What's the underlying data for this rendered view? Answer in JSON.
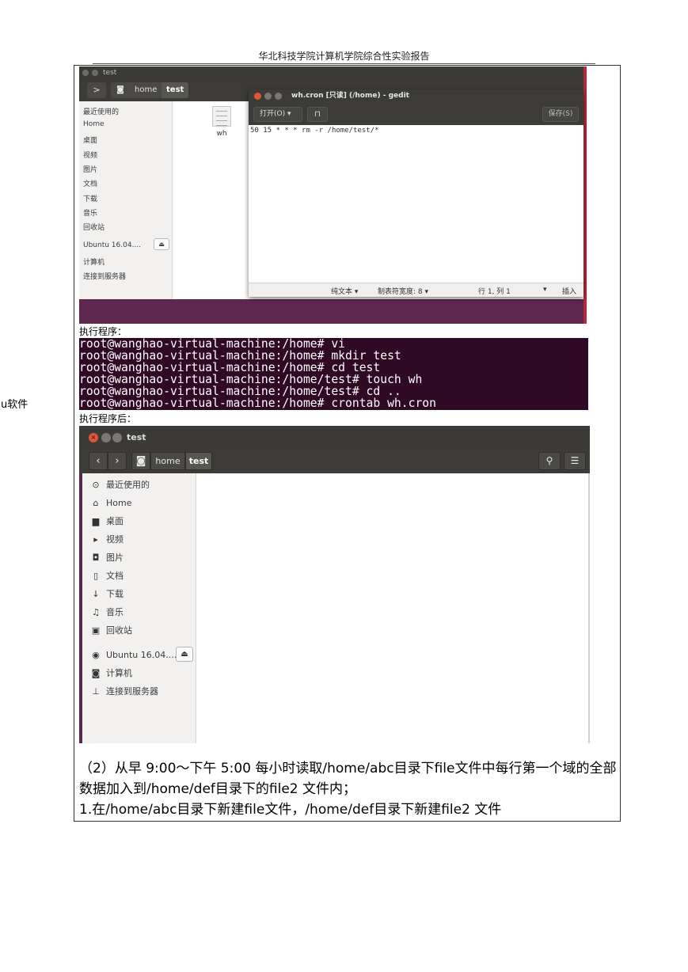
{
  "header": {
    "text": "华北科技学院计算机学院综合性实验报告"
  },
  "screenshot1": {
    "window_title": "test",
    "breadcrumb": {
      "home": "home",
      "current": "test"
    },
    "sidebar": [
      "最近使用的",
      "Home",
      "桌面",
      "视频",
      "图片",
      "文档",
      "下载",
      "音乐",
      "回收站",
      "Ubuntu 16.04....",
      "计算机",
      "连接到服务器"
    ],
    "file_name": "wh",
    "gedit": {
      "title": "wh.cron [只读] (/home) - gedit",
      "open_label": "打开(O) ▾",
      "save_label": "保存(S)",
      "content": "50 15 * * * rm -r /home/test/*",
      "status": {
        "mode": "纯文本 ▾",
        "tab": "制表符宽度: 8 ▾",
        "pos": "行 1, 列 1",
        "insert": "插入"
      }
    }
  },
  "label_before": "执行程序：",
  "terminal": {
    "lines": [
      "root@wanghao-virtual-machine:/home# vi",
      "root@wanghao-virtual-machine:/home# mkdir test",
      "root@wanghao-virtual-machine:/home# cd test",
      "root@wanghao-virtual-machine:/home/test# touch wh",
      "root@wanghao-virtual-machine:/home/test# cd ..",
      "root@wanghao-virtual-machine:/home# crontab wh.cron"
    ],
    "overlay": "u软件"
  },
  "label_after": "执行程序后：",
  "screenshot2": {
    "window_title": "test",
    "breadcrumb": {
      "home": "home",
      "current": "test"
    },
    "sidebar": [
      {
        "icon": "clock-icon",
        "glyph": "⊙",
        "label": "最近使用的"
      },
      {
        "icon": "home-icon",
        "glyph": "⌂",
        "label": "Home"
      },
      {
        "icon": "desktop-folder-icon",
        "glyph": "▆",
        "label": "桌面"
      },
      {
        "icon": "video-icon",
        "glyph": "▸",
        "label": "视频"
      },
      {
        "icon": "camera-icon",
        "glyph": "◘",
        "label": "图片"
      },
      {
        "icon": "document-icon",
        "glyph": "▯",
        "label": "文档"
      },
      {
        "icon": "download-icon",
        "glyph": "↓",
        "label": "下载"
      },
      {
        "icon": "music-icon",
        "glyph": "♫",
        "label": "音乐"
      },
      {
        "icon": "trash-icon",
        "glyph": "▣",
        "label": "回收站"
      },
      {
        "icon": "disc-icon",
        "glyph": "◉",
        "label": "Ubuntu 16.04...."
      },
      {
        "icon": "computer-icon",
        "glyph": "◙",
        "label": "计算机"
      },
      {
        "icon": "server-icon",
        "glyph": "⊥",
        "label": "连接到服务器"
      }
    ]
  },
  "paragraphs": [
    "（2）从早 9:00～下午 5:00 每小时读取/home/abc目录下file文件中每行第一个域的全部数据加入到/home/def目录下的file2 文件内；",
    "1.在/home/abc目录下新建file文件，/home/def目录下新建file2 文件"
  ]
}
